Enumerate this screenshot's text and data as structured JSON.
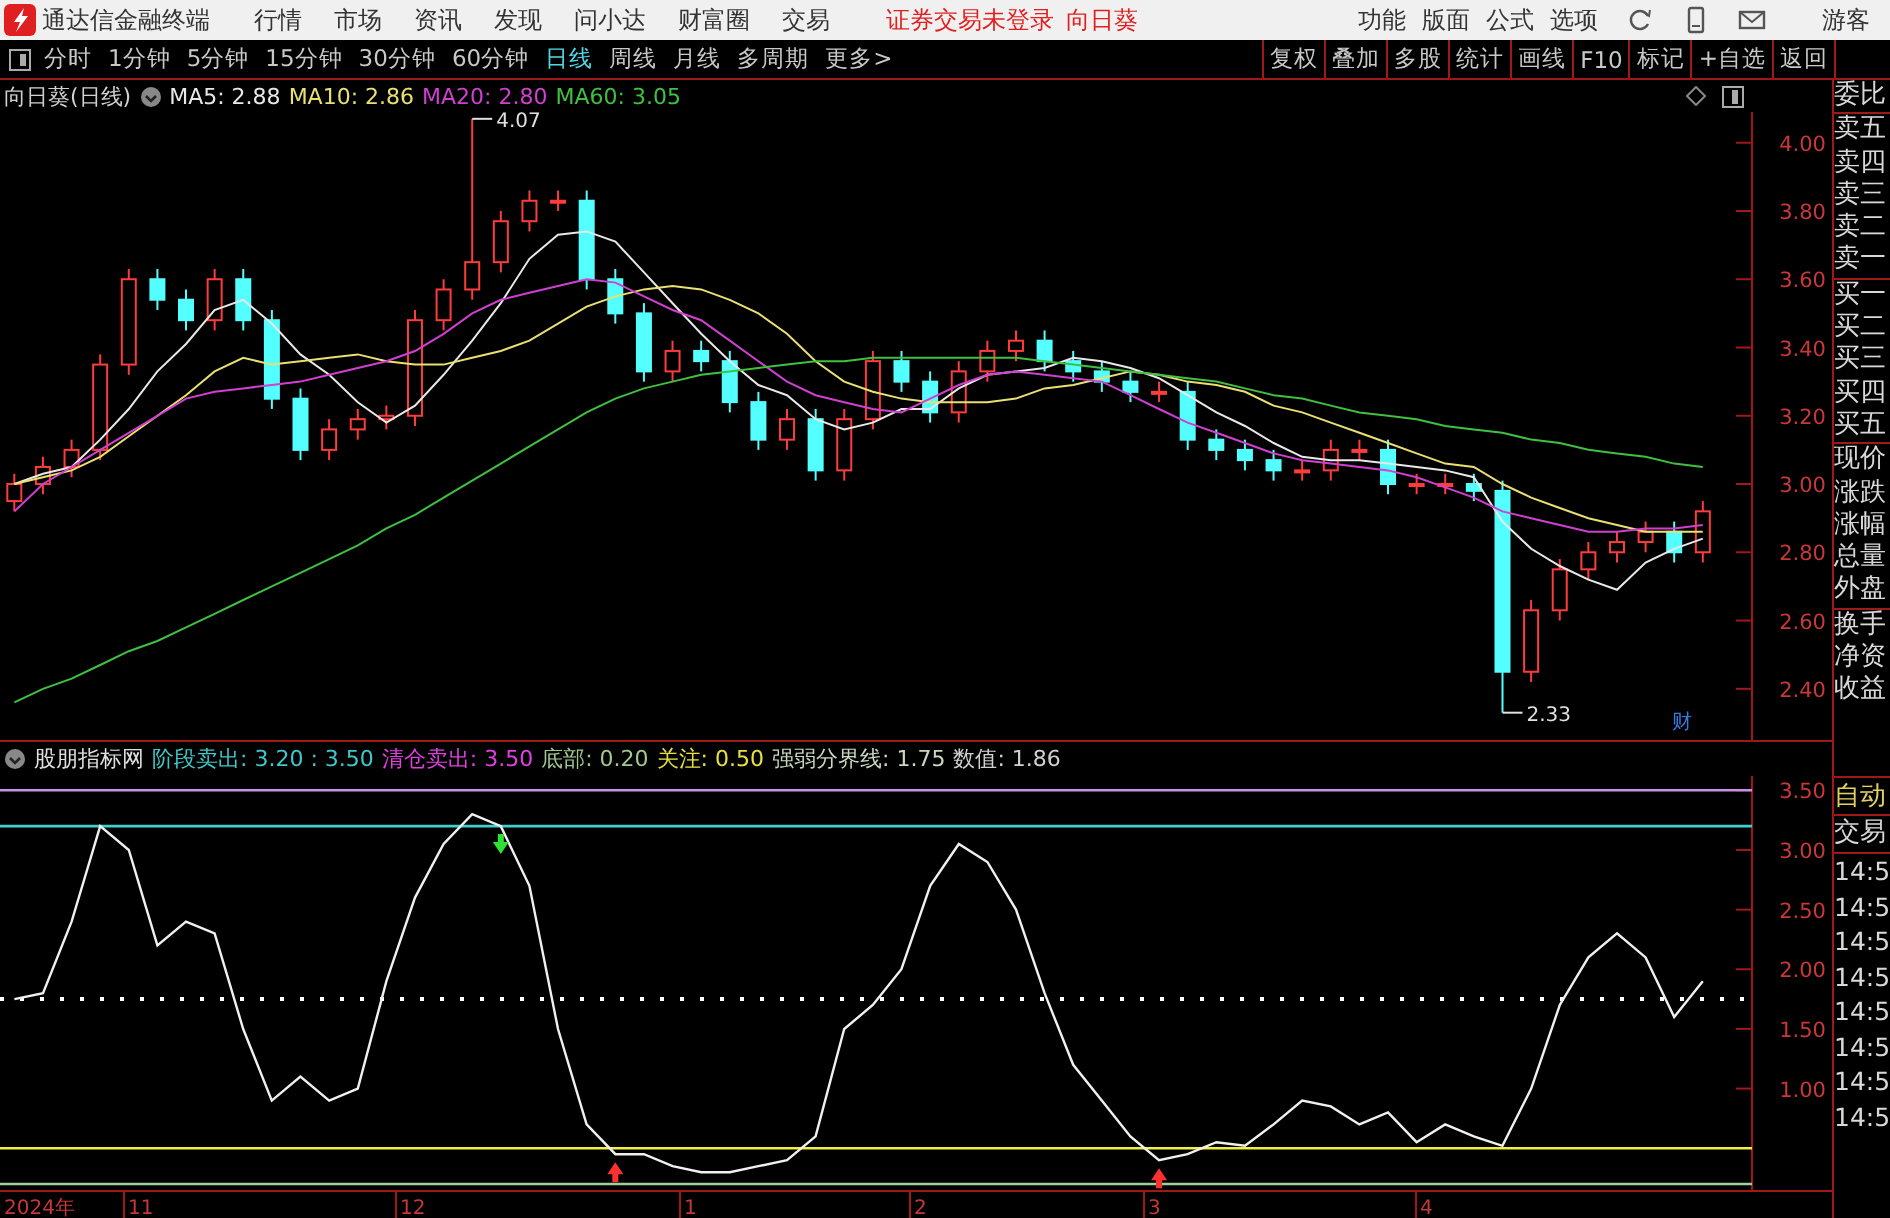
{
  "title_bar": {
    "app_name": "通达信金融终端",
    "menu": [
      "行情",
      "市场",
      "资讯",
      "发现",
      "问小达",
      "财富圈",
      "交易"
    ],
    "login_status": "证券交易未登录",
    "stock_name": "向日葵",
    "right_menu": [
      "功能",
      "版面",
      "公式",
      "选项"
    ],
    "user": "游客"
  },
  "toolbar": {
    "periods": [
      {
        "label": "分时",
        "selected": false
      },
      {
        "label": "1分钟",
        "selected": false
      },
      {
        "label": "5分钟",
        "selected": false
      },
      {
        "label": "15分钟",
        "selected": false
      },
      {
        "label": "30分钟",
        "selected": false
      },
      {
        "label": "60分钟",
        "selected": false
      },
      {
        "label": "日线",
        "selected": true
      },
      {
        "label": "周线",
        "selected": false
      },
      {
        "label": "月线",
        "selected": false
      },
      {
        "label": "多周期",
        "selected": false
      },
      {
        "label": "更多>",
        "selected": false
      }
    ],
    "actions": [
      "复权",
      "叠加",
      "多股",
      "统计",
      "画线",
      "F10",
      "标记",
      "+自选",
      "返回"
    ]
  },
  "price_chart": {
    "title": "向日葵(日线)",
    "legend": [
      {
        "label": "MA5: 2.88",
        "color": "#e8e8e8"
      },
      {
        "label": "MA10: 2.86",
        "color": "#e8e070"
      },
      {
        "label": "MA20: 2.80",
        "color": "#d040d0"
      },
      {
        "label": "MA60: 3.05",
        "color": "#40c040"
      }
    ],
    "badge": "财",
    "chart_data": {
      "type": "candlestick",
      "ylim": [
        2.25,
        4.09
      ],
      "yticks": [
        {
          "value": 2.4,
          "label": "2.40"
        },
        {
          "value": 2.6,
          "label": "2.60"
        },
        {
          "value": 2.8,
          "label": "2.80"
        },
        {
          "value": 3.0,
          "label": "3.00"
        },
        {
          "value": 3.2,
          "label": "3.20"
        },
        {
          "value": 3.4,
          "label": "3.40"
        },
        {
          "value": 3.6,
          "label": "3.60"
        },
        {
          "value": 3.8,
          "label": "3.80"
        },
        {
          "value": 4.0,
          "label": "4.00"
        }
      ],
      "ohlc": [
        [
          2.95,
          3.03,
          2.92,
          3.0
        ],
        [
          3.0,
          3.08,
          2.97,
          3.05
        ],
        [
          3.05,
          3.13,
          3.02,
          3.1
        ],
        [
          3.1,
          3.38,
          3.07,
          3.35
        ],
        [
          3.35,
          3.63,
          3.32,
          3.6
        ],
        [
          3.6,
          3.63,
          3.51,
          3.54
        ],
        [
          3.54,
          3.57,
          3.45,
          3.48
        ],
        [
          3.48,
          3.63,
          3.45,
          3.6
        ],
        [
          3.6,
          3.63,
          3.45,
          3.48
        ],
        [
          3.48,
          3.51,
          3.22,
          3.25
        ],
        [
          3.25,
          3.28,
          3.07,
          3.1
        ],
        [
          3.1,
          3.19,
          3.07,
          3.16
        ],
        [
          3.16,
          3.22,
          3.13,
          3.19
        ],
        [
          3.19,
          3.23,
          3.16,
          3.2
        ],
        [
          3.2,
          3.51,
          3.17,
          3.48
        ],
        [
          3.48,
          3.6,
          3.45,
          3.57
        ],
        [
          3.57,
          4.07,
          3.54,
          3.65
        ],
        [
          3.65,
          3.8,
          3.62,
          3.77
        ],
        [
          3.77,
          3.86,
          3.74,
          3.83
        ],
        [
          3.83,
          3.86,
          3.8,
          3.83
        ],
        [
          3.83,
          3.86,
          3.57,
          3.6
        ],
        [
          3.6,
          3.63,
          3.47,
          3.5
        ],
        [
          3.5,
          3.53,
          3.3,
          3.33
        ],
        [
          3.33,
          3.42,
          3.3,
          3.39
        ],
        [
          3.39,
          3.42,
          3.33,
          3.36
        ],
        [
          3.36,
          3.39,
          3.21,
          3.24
        ],
        [
          3.24,
          3.27,
          3.1,
          3.13
        ],
        [
          3.13,
          3.22,
          3.1,
          3.19
        ],
        [
          3.19,
          3.22,
          3.01,
          3.04
        ],
        [
          3.04,
          3.22,
          3.01,
          3.19
        ],
        [
          3.19,
          3.39,
          3.16,
          3.36
        ],
        [
          3.36,
          3.39,
          3.27,
          3.3
        ],
        [
          3.3,
          3.33,
          3.18,
          3.21
        ],
        [
          3.21,
          3.36,
          3.18,
          3.33
        ],
        [
          3.33,
          3.42,
          3.3,
          3.39
        ],
        [
          3.39,
          3.45,
          3.36,
          3.42
        ],
        [
          3.42,
          3.45,
          3.33,
          3.36
        ],
        [
          3.36,
          3.39,
          3.3,
          3.33
        ],
        [
          3.33,
          3.36,
          3.27,
          3.3
        ],
        [
          3.3,
          3.33,
          3.24,
          3.27
        ],
        [
          3.27,
          3.3,
          3.24,
          3.27
        ],
        [
          3.27,
          3.3,
          3.1,
          3.13
        ],
        [
          3.13,
          3.16,
          3.07,
          3.1
        ],
        [
          3.1,
          3.13,
          3.04,
          3.07
        ],
        [
          3.07,
          3.1,
          3.01,
          3.04
        ],
        [
          3.04,
          3.07,
          3.01,
          3.04
        ],
        [
          3.04,
          3.13,
          3.01,
          3.1
        ],
        [
          3.1,
          3.13,
          3.07,
          3.1
        ],
        [
          3.1,
          3.13,
          2.97,
          3.0
        ],
        [
          3.0,
          3.03,
          2.97,
          3.0
        ],
        [
          3.0,
          3.03,
          2.97,
          3.0
        ],
        [
          3.0,
          3.03,
          2.95,
          2.98
        ],
        [
          2.98,
          3.01,
          2.33,
          2.45
        ],
        [
          2.45,
          2.66,
          2.42,
          2.63
        ],
        [
          2.63,
          2.78,
          2.6,
          2.75
        ],
        [
          2.75,
          2.83,
          2.72,
          2.8
        ],
        [
          2.8,
          2.86,
          2.77,
          2.83
        ],
        [
          2.83,
          2.89,
          2.8,
          2.86
        ],
        [
          2.86,
          2.89,
          2.77,
          2.8
        ],
        [
          2.8,
          2.95,
          2.77,
          2.92
        ]
      ],
      "series": [
        {
          "type": "line",
          "color": "#e8e8e8",
          "values": [
            3.0,
            3.03,
            3.05,
            3.13,
            3.22,
            3.33,
            3.41,
            3.51,
            3.54,
            3.47,
            3.38,
            3.32,
            3.24,
            3.18,
            3.23,
            3.32,
            3.42,
            3.53,
            3.66,
            3.73,
            3.74,
            3.71,
            3.62,
            3.53,
            3.44,
            3.36,
            3.29,
            3.26,
            3.19,
            3.16,
            3.18,
            3.22,
            3.22,
            3.28,
            3.32,
            3.33,
            3.34,
            3.37,
            3.36,
            3.34,
            3.31,
            3.26,
            3.21,
            3.17,
            3.12,
            3.08,
            3.07,
            3.07,
            3.06,
            3.05,
            3.04,
            3.02,
            2.89,
            2.81,
            2.76,
            2.72,
            2.69,
            2.77,
            2.81,
            2.84
          ]
        },
        {
          "type": "line",
          "color": "#e8e070",
          "values": [
            3.0,
            3.02,
            3.04,
            3.08,
            3.14,
            3.2,
            3.26,
            3.33,
            3.37,
            3.35,
            3.36,
            3.37,
            3.38,
            3.36,
            3.35,
            3.35,
            3.37,
            3.39,
            3.42,
            3.47,
            3.52,
            3.55,
            3.57,
            3.58,
            3.57,
            3.54,
            3.5,
            3.44,
            3.36,
            3.3,
            3.27,
            3.25,
            3.24,
            3.24,
            3.24,
            3.25,
            3.28,
            3.29,
            3.31,
            3.33,
            3.32,
            3.3,
            3.29,
            3.27,
            3.23,
            3.21,
            3.18,
            3.15,
            3.12,
            3.09,
            3.06,
            3.05,
            3.0,
            2.96,
            2.93,
            2.9,
            2.88,
            2.86,
            2.86,
            2.86
          ]
        },
        {
          "type": "line",
          "color": "#d040d0",
          "values": [
            2.92,
            3.0,
            3.05,
            3.1,
            3.15,
            3.2,
            3.25,
            3.27,
            3.28,
            3.29,
            3.3,
            3.32,
            3.34,
            3.36,
            3.39,
            3.44,
            3.5,
            3.54,
            3.56,
            3.58,
            3.6,
            3.59,
            3.55,
            3.51,
            3.48,
            3.42,
            3.36,
            3.3,
            3.26,
            3.24,
            3.22,
            3.21,
            3.25,
            3.29,
            3.32,
            3.33,
            3.32,
            3.31,
            3.3,
            3.26,
            3.22,
            3.18,
            3.15,
            3.12,
            3.09,
            3.07,
            3.06,
            3.05,
            3.04,
            3.02,
            2.99,
            2.96,
            2.92,
            2.9,
            2.88,
            2.86,
            2.86,
            2.87,
            2.87,
            2.88
          ]
        },
        {
          "type": "line",
          "color": "#40c040",
          "values": [
            2.36,
            2.4,
            2.43,
            2.47,
            2.51,
            2.54,
            2.58,
            2.62,
            2.66,
            2.7,
            2.74,
            2.78,
            2.82,
            2.87,
            2.91,
            2.96,
            3.01,
            3.06,
            3.11,
            3.16,
            3.21,
            3.25,
            3.28,
            3.3,
            3.32,
            3.33,
            3.34,
            3.35,
            3.36,
            3.36,
            3.37,
            3.37,
            3.37,
            3.37,
            3.37,
            3.37,
            3.36,
            3.35,
            3.34,
            3.33,
            3.32,
            3.31,
            3.3,
            3.28,
            3.26,
            3.25,
            3.23,
            3.21,
            3.2,
            3.19,
            3.17,
            3.16,
            3.15,
            3.13,
            3.12,
            3.1,
            3.09,
            3.08,
            3.06,
            3.05
          ]
        }
      ],
      "annotations": [
        "4.07",
        "2.33"
      ]
    }
  },
  "indicator": {
    "name": "股朋指标网",
    "legend": [
      {
        "label": "阶段卖出: 3.20 : 3.50",
        "color": "#40c8c8"
      },
      {
        "label": "清仓卖出: 3.50",
        "color": "#e040e0"
      },
      {
        "label": "底部: 0.20",
        "color": "#a0c890"
      },
      {
        "label": "关注: 0.50",
        "color": "#e8e040"
      },
      {
        "label": "强弱分界线: 1.75",
        "color": "#c8d8c0"
      },
      {
        "label": "数值: 1.86",
        "color": "#d0d0d0"
      }
    ],
    "chart_data": {
      "type": "line",
      "ylim": [
        0.15,
        3.62
      ],
      "yticks": [
        {
          "value": 1.0,
          "label": "1.00"
        },
        {
          "value": 1.5,
          "label": "1.50"
        },
        {
          "value": 2.0,
          "label": "2.00"
        },
        {
          "value": 2.5,
          "label": "2.50"
        },
        {
          "value": 3.0,
          "label": "3.00"
        },
        {
          "value": 3.5,
          "label": "3.50"
        }
      ],
      "series": [
        {
          "color": "#f0f0f0",
          "values": [
            1.75,
            1.8,
            2.4,
            3.2,
            3.0,
            2.2,
            2.4,
            2.3,
            1.5,
            0.9,
            1.1,
            0.9,
            1.0,
            1.9,
            2.6,
            3.05,
            3.3,
            3.2,
            2.7,
            1.5,
            0.7,
            0.45,
            0.45,
            0.35,
            0.3,
            0.3,
            0.35,
            0.4,
            0.6,
            1.5,
            1.7,
            2.0,
            2.7,
            3.05,
            2.9,
            2.5,
            1.8,
            1.2,
            0.9,
            0.6,
            0.4,
            0.45,
            0.55,
            0.52,
            0.7,
            0.9,
            0.85,
            0.7,
            0.8,
            0.55,
            0.7,
            0.6,
            0.52,
            1.0,
            1.7,
            2.1,
            2.3,
            2.1,
            1.6,
            1.9
          ]
        }
      ],
      "ref_lines": [
        {
          "axis": "y",
          "value": 3.5,
          "color": "#c890e8"
        },
        {
          "axis": "y",
          "value": 3.2,
          "color": "#40d0d0"
        },
        {
          "axis": "y",
          "value": 1.75,
          "color": "#ffffff"
        },
        {
          "axis": "y",
          "value": 0.5,
          "color": "#f0f040"
        },
        {
          "axis": "y",
          "value": 0.2,
          "color": "#a0d0a0"
        }
      ]
    }
  },
  "date_axis": [
    "2024年",
    "11",
    "12",
    "1",
    "2",
    "3",
    "4"
  ],
  "quote_panel": {
    "groups": [
      [
        "委比"
      ],
      [
        "卖五",
        "卖四",
        "卖三",
        "卖二",
        "卖一"
      ],
      [
        "买一",
        "买二",
        "买三",
        "买四",
        "买五"
      ],
      [
        "现价",
        "涨跌",
        "涨幅",
        "总量",
        "外盘"
      ],
      [
        "换手",
        "净资",
        "收益"
      ]
    ]
  },
  "trade_panel": {
    "mode": "自动",
    "label": "交易",
    "times": [
      "14:5",
      "14:5",
      "14:5",
      "14:5",
      "14:5",
      "14:5",
      "14:5",
      "14:5"
    ]
  }
}
